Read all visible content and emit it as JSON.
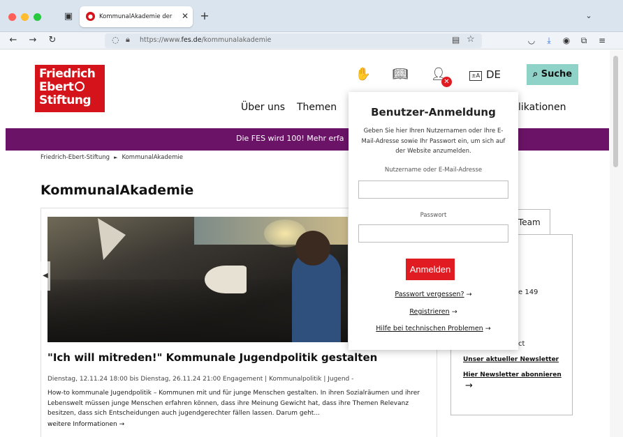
{
  "browser": {
    "tab_title": "KommunalAkademie der Friedrich-Ebert-Stiftung",
    "tab_close": "✕",
    "new_tab": "+",
    "list_tabs": "⌄",
    "url_prefix": "https://www.",
    "url_domain": "fes.de",
    "url_path": "/kommunalakademie",
    "icons": [
      "back-icon",
      "forward-icon",
      "reload-icon",
      "shield-icon",
      "lock-icon",
      "reader-icon",
      "bookmark-star-icon",
      "pocket-icon",
      "downloads-icon",
      "account-icon",
      "extensions-icon",
      "menu-icon"
    ]
  },
  "header": {
    "logo_lines": [
      "Friedrich",
      "Ebert",
      "Stiftung"
    ],
    "lang": "DE",
    "lang_icon": "±A",
    "search_label": "Suche",
    "icons": [
      "sign-language-icon",
      "easy-language-icon",
      "user-icon",
      "logout-x-icon",
      "translate-icon",
      "search-icon"
    ]
  },
  "nav": {
    "items": [
      "Über uns",
      "Themen",
      "likationen"
    ]
  },
  "banner": {
    "text": "Die FES wird 100! Mehr erfa"
  },
  "breadcrumb": {
    "items": [
      "Friedrich-Ebert-Stiftung",
      "KommunalAkademie"
    ],
    "separator": "►"
  },
  "page": {
    "title": "KommunalAkademie"
  },
  "event": {
    "title": "\"Ich will mitreden!\" Kommunale Jugendpolitik gestalten",
    "meta": "Dienstag, 12.11.24 18:00 bis Dienstag, 26.11.24 21:00 Engagement | Kommunalpolitik | Jugend -",
    "description": "How-to kommunale Jugendpolitik – Kommunen mit und für junge Menschen gestalten. In ihren Sozialräumen und ihrer Lebenswelt müssen junge Menschen erfahren können, dass ihre Meinung Gewicht hat, dass ihre Themen Relevanz besitzen, dass sich Entscheidungen auch jugendgerechter fällen lassen. Darum geht...",
    "more_link": "weitere Informationen →"
  },
  "sidebar": {
    "tab_label": "Team",
    "fragment_1": "e 149",
    "fragment_2": "ct",
    "link_1": "Unser aktueller Newsletter",
    "link_2": "Hier Newsletter abonnieren",
    "arrow": "→"
  },
  "login": {
    "title": "Benutzer-Anmeldung",
    "intro": "Geben Sie hier Ihren Nutzernamen oder Ihre E-Mail-Adresse sowie Ihr Passwort ein, um sich auf der Website anzumelden.",
    "username_label": "Nutzername oder E-Mail-Adresse",
    "username_value": "",
    "password_label": "Passwort",
    "password_value": "",
    "submit_label": "Anmelden",
    "forgot_link": "Passwort vergessen?",
    "register_link": "Registrieren",
    "help_link": "Hilfe bei technischen Problemen",
    "link_arrow": "→"
  },
  "colors": {
    "brand_red": "#d4141a",
    "banner_purple": "#6b1467",
    "search_teal": "#8fd3c8",
    "login_button": "#e11b22"
  }
}
